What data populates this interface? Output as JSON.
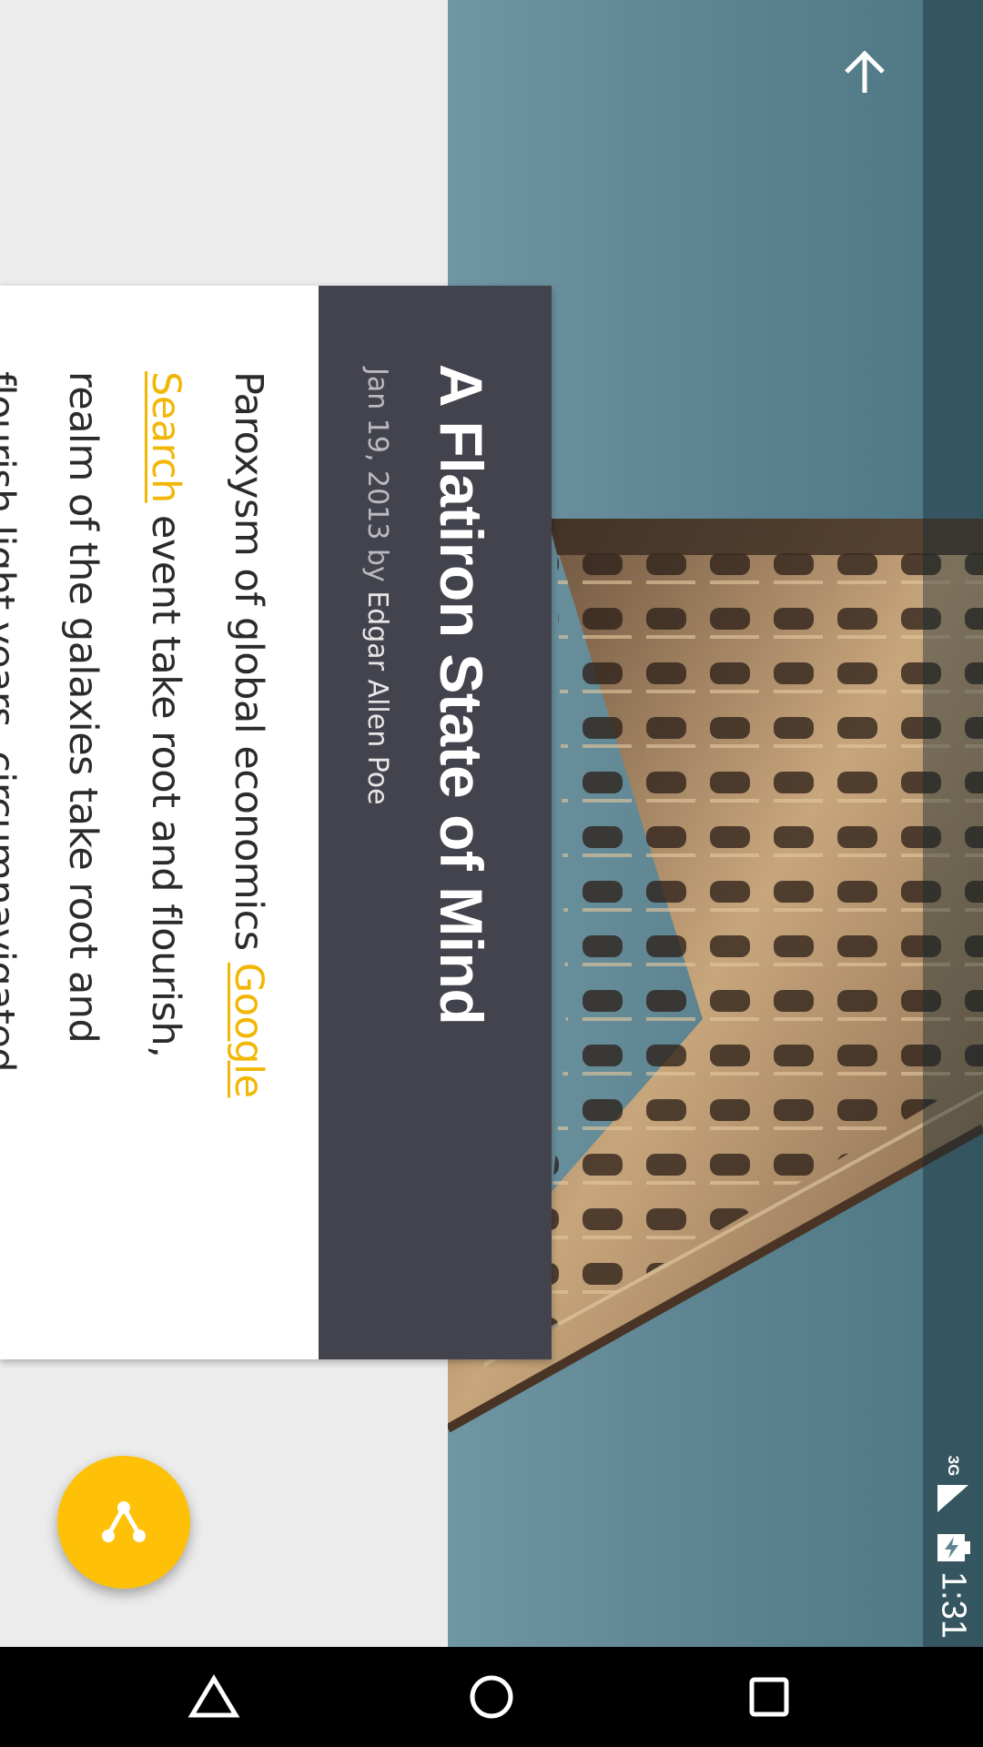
{
  "article": {
    "title": "A Flatiron State of Mind",
    "date": "Jan 19, 2013",
    "by": "by",
    "author": "Edgar Allen Poe",
    "lines": [
      {
        "pre": "Paroxysm of global economics ",
        "link": "Google",
        "post": ""
      },
      {
        "pre": "",
        "link": "Search",
        "post": " event take root and flourish,"
      },
      {
        "pre": "realm of the galaxies take root and",
        "link": "",
        "post": ""
      },
      {
        "pre": "flourish light years, circumnavigated",
        "link": "",
        "post": ""
      }
    ]
  },
  "status_bar": {
    "time": "1:31",
    "network": "3G",
    "icons": [
      "signal-icon",
      "battery-charging-icon"
    ]
  },
  "toolbar": {
    "up_icon": "arrow-up-icon"
  },
  "fab": {
    "icon": "share-icon",
    "color": "#ffc107"
  },
  "nav_bar": {
    "icons": [
      "back-triangle-icon",
      "home-circle-icon",
      "recents-square-icon"
    ]
  },
  "colors": {
    "accent": "#ffc107",
    "link": "#f2b705",
    "header_bg": "#43434d",
    "background": "#ececec"
  }
}
